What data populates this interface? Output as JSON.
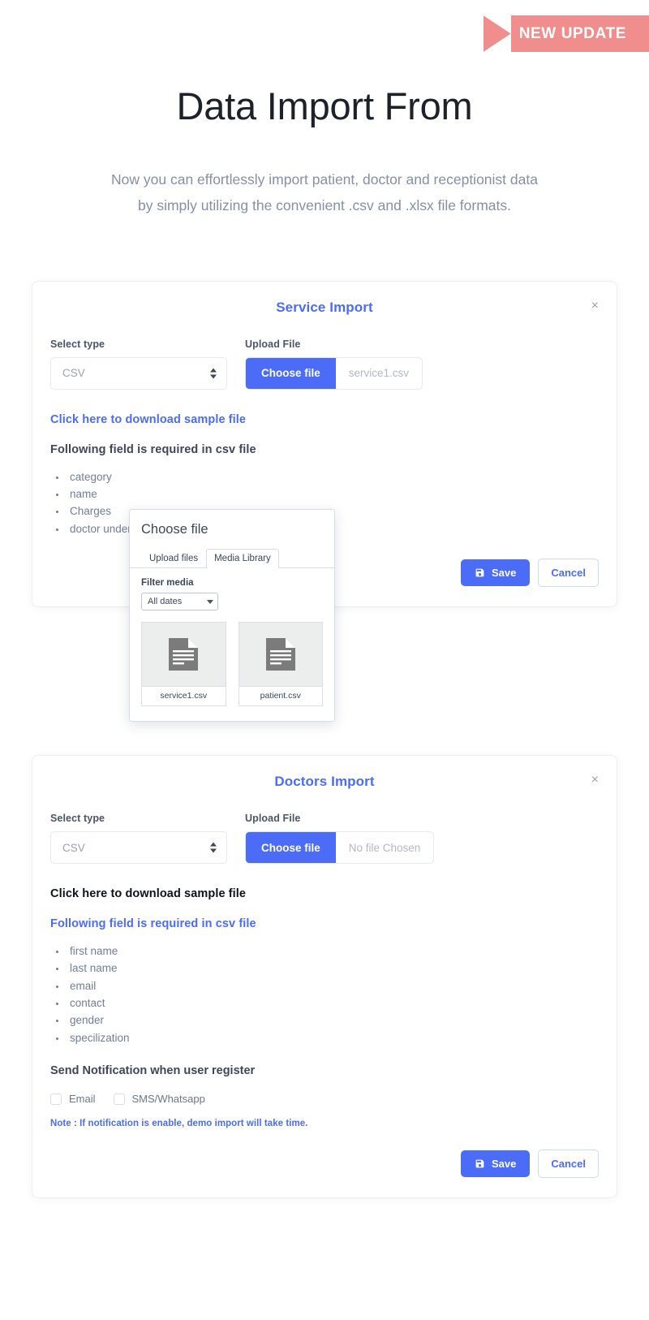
{
  "ribbon": {
    "label": "NEW UPDATE",
    "color": "#f08d8d"
  },
  "hero": {
    "title": "Data Import From",
    "description": "Now you can effortlessly import patient, doctor and receptionist data by simply utilizing the convenient .csv and .xlsx file formats."
  },
  "cards": [
    {
      "title": "Service Import",
      "close_label": "×",
      "select_type_label": "Select type",
      "select_value": "CSV",
      "upload_label": "Upload File",
      "choose_file_label": "Choose file",
      "file_name": "service1.csv",
      "sample_link": "Click here to download sample file",
      "required_title": "Following field is required in csv file",
      "required_fields": [
        "category",
        "name",
        "Charges",
        "doctor under"
      ],
      "save_label": "Save",
      "cancel_label": "Cancel"
    },
    {
      "title": "Doctors Import",
      "close_label": "×",
      "select_type_label": "Select type",
      "select_value": "CSV",
      "upload_label": "Upload File",
      "choose_file_label": "Choose file",
      "file_name": "No file Chosen",
      "sample_link": "Click here to download sample file",
      "required_title": "Following field is required in csv file",
      "required_fields": [
        "first name",
        "last name",
        "email",
        "contact",
        "gender",
        "specilization"
      ],
      "notify_title": "Send Notification when user register",
      "checkboxes": [
        {
          "label": "Email",
          "checked": false
        },
        {
          "label": "SMS/Whatsapp",
          "checked": false
        }
      ],
      "note": "Note : If notification is enable, demo import will take time.",
      "save_label": "Save",
      "cancel_label": "Cancel"
    }
  ],
  "popup": {
    "title": "Choose file",
    "tabs": [
      {
        "label": "Upload files",
        "active": false
      },
      {
        "label": "Media Library",
        "active": true
      }
    ],
    "filter_label": "Filter media",
    "filter_value": "All dates",
    "media": [
      {
        "name": "service1.csv"
      },
      {
        "name": "patient.csv"
      }
    ]
  },
  "theme": {
    "accent": "#4a6cf7",
    "ribbon": "#f08d8d",
    "muted": "#8590a6"
  }
}
